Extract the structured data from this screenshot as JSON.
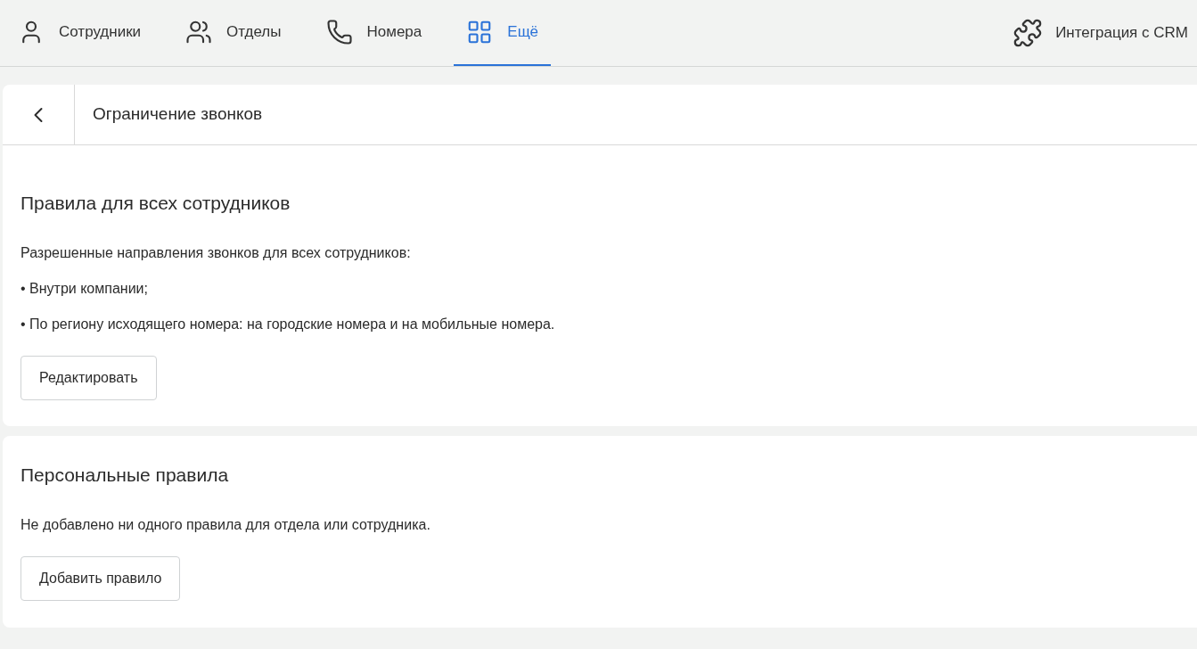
{
  "nav": {
    "tabs": [
      {
        "label": "Сотрудники",
        "kind": "user",
        "selected": false
      },
      {
        "label": "Отделы",
        "kind": "users",
        "selected": false
      },
      {
        "label": "Номера",
        "kind": "phone",
        "selected": false
      },
      {
        "label": "Ещё",
        "kind": "grid",
        "selected": true
      }
    ],
    "right_link": {
      "label": "Интеграция с CRM"
    }
  },
  "page": {
    "title": "Ограничение звонков"
  },
  "sections": [
    {
      "heading": "Правила для всех сотрудников",
      "lines": [
        "Разрешенные направления звонков для всех сотрудников:",
        "• Внутри компании;",
        "• По региону исходящего номера: на городские номера и на мобильные номера."
      ],
      "button": "Редактировать"
    },
    {
      "heading": "Персональные правила",
      "lines": [
        "Не добавлено ни одного правила для отдела или сотрудника."
      ],
      "button": "Добавить правило"
    }
  ]
}
